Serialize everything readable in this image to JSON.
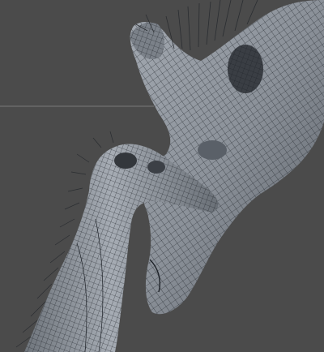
{
  "viewport": {
    "view": "perspective",
    "display_mode": "wireframe-on-shaded",
    "background_color": "#4b4b4b",
    "mesh_color": "#8a9099",
    "wire_color": "#1e2228",
    "objects": [
      "adult-giraffe-head-mesh",
      "baby-giraffe-head-mesh"
    ]
  }
}
